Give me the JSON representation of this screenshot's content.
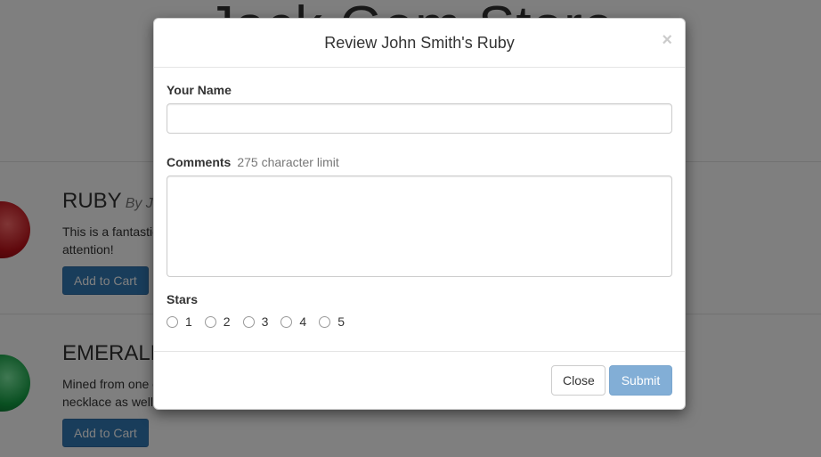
{
  "background": {
    "store_title": "Jack Gem Store",
    "products": [
      {
        "name": "RUBY",
        "by": "By J",
        "description_line1": "This is a fantastic gem. It will sparkle and catch the eye of anyone looking for",
        "description_line2": "attention!",
        "add_to_cart_label": "Add to Cart"
      },
      {
        "name": "EMERALD",
        "description_line1": "Mined from one of the deepest caves, this emerald will look good in a",
        "description_line2": "necklace as well",
        "add_to_cart_label": "Add to Cart"
      }
    ]
  },
  "modal": {
    "title": "Review John Smith's Ruby",
    "close_x": "×",
    "fields": {
      "name_label": "Your Name",
      "name_value": "",
      "comments_label": "Comments",
      "comments_hint": "275 character limit",
      "comments_value": "",
      "stars_label": "Stars",
      "star_options": [
        "1",
        "2",
        "3",
        "4",
        "5"
      ]
    },
    "footer": {
      "close_label": "Close",
      "submit_label": "Submit"
    }
  },
  "colors": {
    "primary": "#337ab7",
    "submit_disabled": "#82aed6",
    "backdrop": "rgba(0,0,0,0.5)"
  }
}
